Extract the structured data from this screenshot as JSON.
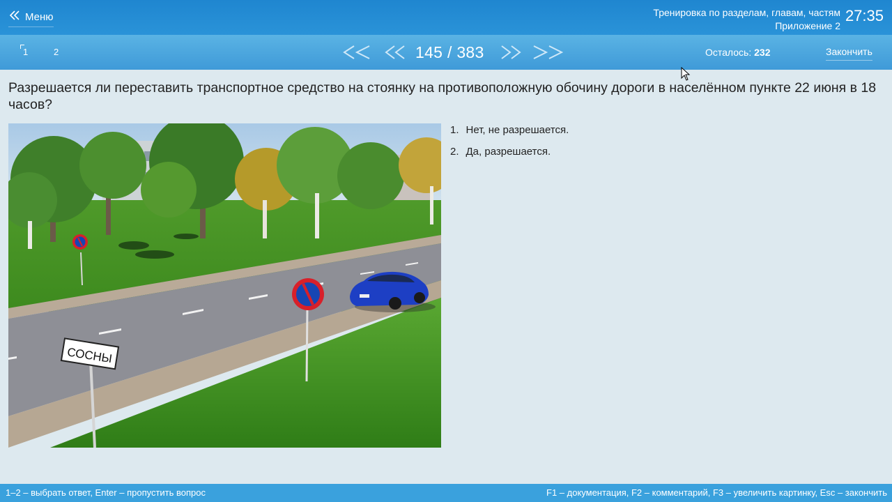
{
  "header": {
    "menu_label": "Меню",
    "title_line1": "Тренировка по разделам, главам, частям",
    "title_line2": "Приложение 2",
    "timer": "27:35"
  },
  "nav": {
    "page_tabs": [
      "1",
      "2"
    ],
    "counter": "145 / 383",
    "remaining_label": "Осталось:",
    "remaining_value": "232",
    "finish_label": "Закончить"
  },
  "question": {
    "text": "Разрешается ли переставить транспортное средство на стоянку на противоположную обочину дороги в населённом пункте 22 июня в 18 часов?",
    "sign_text": "СОСНЫ",
    "answers": [
      {
        "num": "1.",
        "text": "Нет, не разрешается."
      },
      {
        "num": "2.",
        "text": "Да, разрешается."
      }
    ]
  },
  "footer": {
    "hint_left": "1–2 – выбрать ответ, Enter – пропустить вопрос",
    "hint_right": "F1 – документация, F2 – комментарий, F3 – увеличить картинку, Esc – закончить"
  },
  "colors": {
    "topbar": "#2a93d8",
    "navbar": "#4aa6dd",
    "background": "#dde9ef",
    "footer": "#3aa1dd",
    "car": "#1d3fc4",
    "sign_red": "#d8202a",
    "sign_blue": "#1746b3"
  },
  "icons": {
    "menu": "double-chevron-left-icon",
    "first": "double-chevron-left-icon",
    "prev": "chevron-left-icon",
    "next": "chevron-right-icon",
    "last": "double-chevron-right-icon"
  }
}
